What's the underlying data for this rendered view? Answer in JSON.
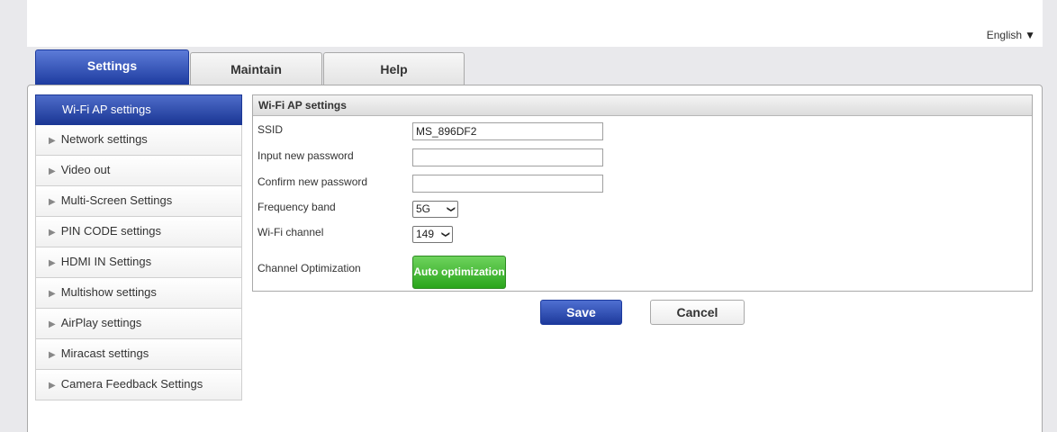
{
  "header": {
    "language": "English",
    "language_icon": "caret-down-icon"
  },
  "tabs": [
    {
      "label": "Settings",
      "active": true
    },
    {
      "label": "Maintain",
      "active": false
    },
    {
      "label": "Help",
      "active": false
    }
  ],
  "sidebar": {
    "items": [
      {
        "label": "Wi-Fi AP settings",
        "active": true
      },
      {
        "label": "Network settings"
      },
      {
        "label": "Video out"
      },
      {
        "label": "Multi-Screen Settings"
      },
      {
        "label": "PIN CODE settings"
      },
      {
        "label": "HDMI IN Settings"
      },
      {
        "label": "Multishow settings"
      },
      {
        "label": "AirPlay settings"
      },
      {
        "label": "Miracast settings"
      },
      {
        "label": "Camera Feedback Settings"
      }
    ]
  },
  "form": {
    "title": "Wi-Fi AP settings",
    "ssid": {
      "label": "SSID",
      "value": "MS_896DF2"
    },
    "new_password": {
      "label": "Input new password",
      "value": ""
    },
    "confirm_password": {
      "label": "Confirm new password",
      "value": ""
    },
    "frequency_band": {
      "label": "Frequency band",
      "value": "5G"
    },
    "wifi_channel": {
      "label": "Wi-Fi channel",
      "value": "149"
    },
    "channel_optimization": {
      "label": "Channel Optimization",
      "button": "Auto optimization"
    }
  },
  "actions": {
    "save": "Save",
    "cancel": "Cancel"
  },
  "colors": {
    "accent": "#1c3a9e",
    "green": "#2aa51c"
  }
}
